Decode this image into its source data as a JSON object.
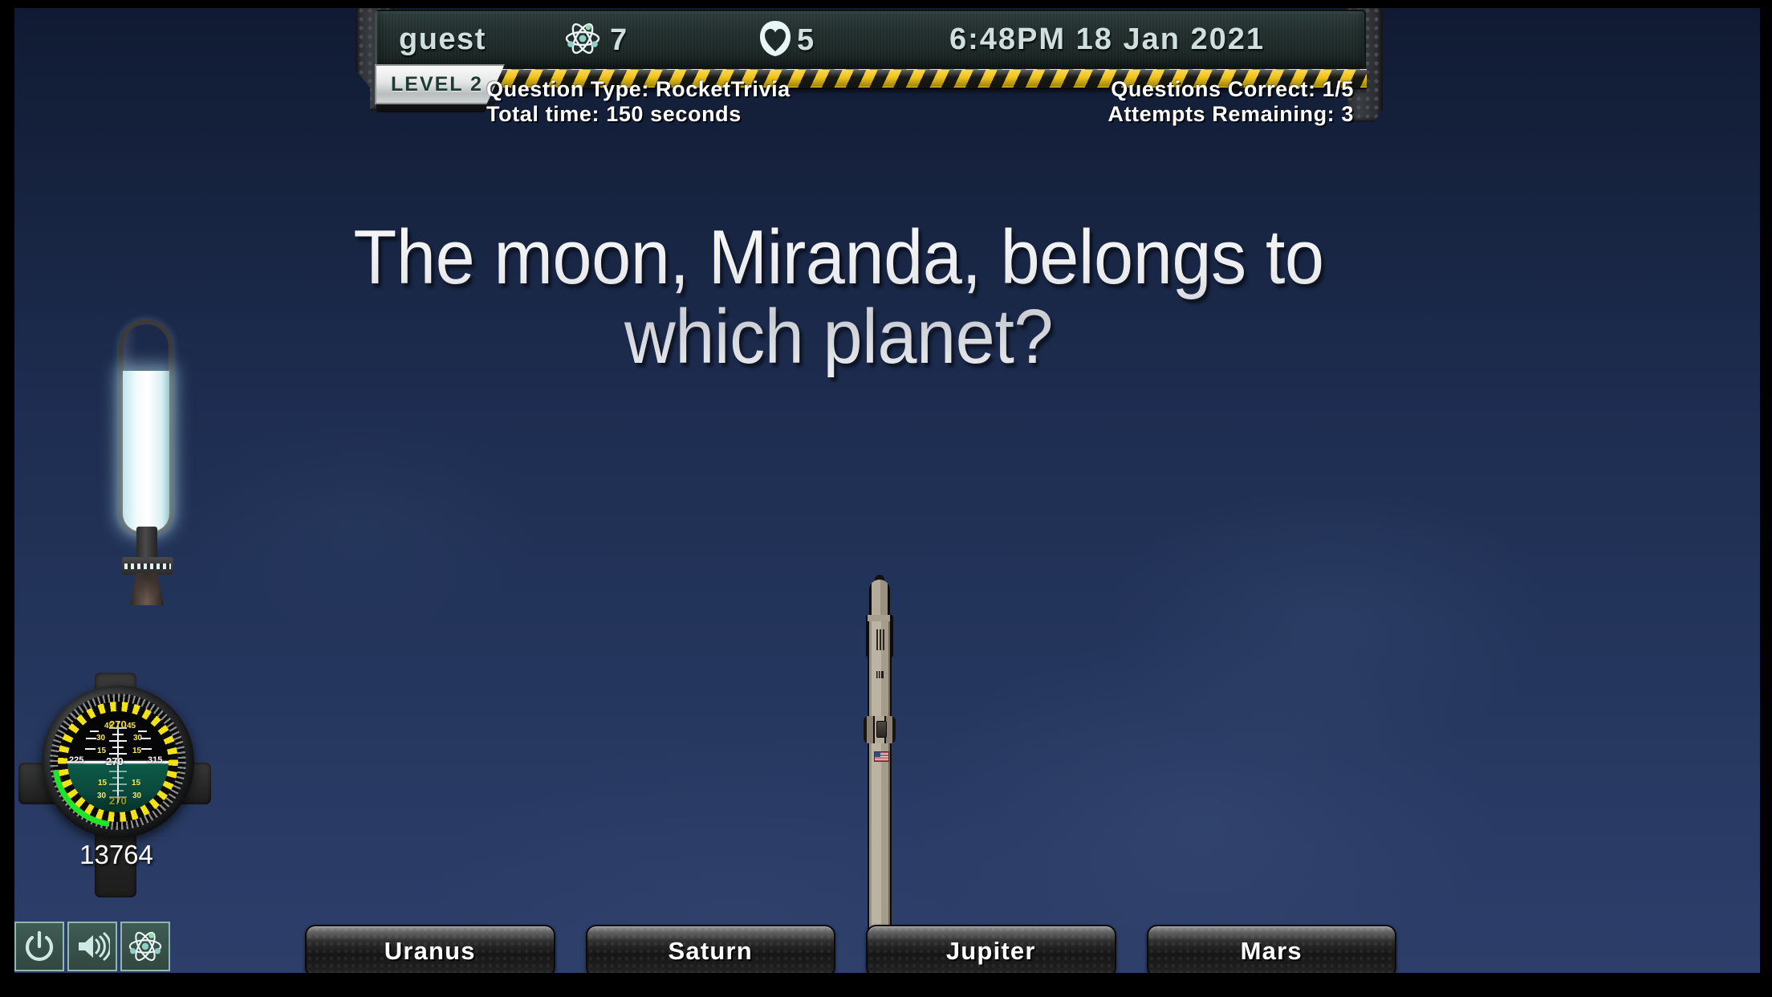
{
  "app": {
    "title": "Rocket Trivia"
  },
  "hud": {
    "username": "guest",
    "atom_count": "7",
    "lives_count": "5",
    "time": "6:48PM  18 Jan 2021",
    "level_label": "LEVEL 2",
    "question_type_label": "Question Type: RocketTrivia",
    "total_time_label": "Total time: 150 seconds",
    "questions_correct_label": "Questions Correct: 1/5",
    "attempts_remaining_label": "Attempts Remaining: 3",
    "icons": {
      "atom": "atom-icon",
      "life": "heart-icon"
    }
  },
  "question": {
    "text": "The moon, Miranda, belongs to which planet?"
  },
  "answers": [
    {
      "label": "Uranus"
    },
    {
      "label": "Saturn"
    },
    {
      "label": "Jupiter"
    },
    {
      "label": "Mars"
    }
  ],
  "instruments": {
    "fuel_tank": {
      "name": "fuel-tank-gauge",
      "fill_percent": 75
    },
    "attitude_indicator": {
      "name": "attitude-indicator",
      "readout": "13764",
      "heading_center": "270",
      "heading_left": "225",
      "heading_right": "315",
      "pitch_labels": [
        "45",
        "30",
        "15",
        "15",
        "30",
        "45"
      ],
      "top_heading": "270",
      "bottom_heading": "270"
    }
  },
  "controls": [
    {
      "label": "Power",
      "icon": "power-icon"
    },
    {
      "label": "Sound",
      "icon": "volume-icon"
    },
    {
      "label": "Science",
      "icon": "atom-icon"
    }
  ],
  "colors": {
    "sky_top": "#101a33",
    "sky_bottom": "#2c3e69",
    "hazard_yellow": "#f2c61a",
    "hud_panel": "#24302f",
    "accent_cyan": "#cfdede",
    "adi_green": "#1fe52a",
    "adi_yellow": "#f2e215"
  }
}
